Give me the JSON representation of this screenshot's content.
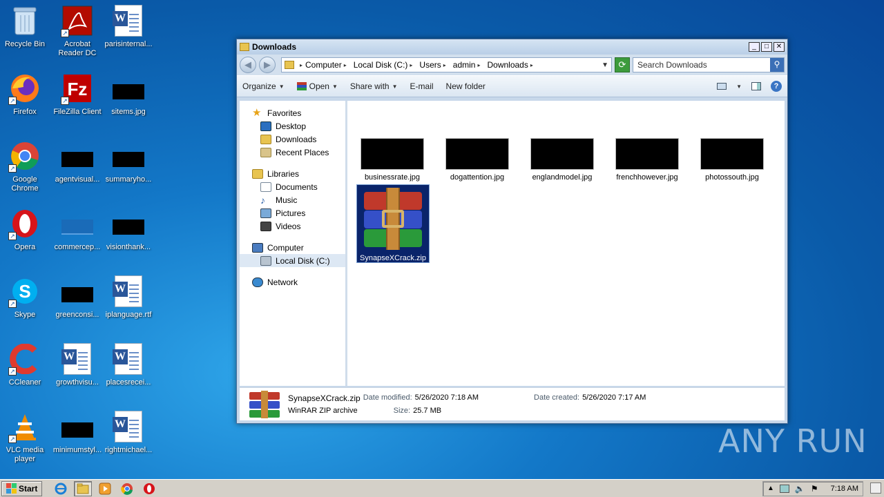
{
  "desktop": {
    "icons": [
      {
        "label": "Recycle Bin",
        "icon": "recycle-bin-icon"
      },
      {
        "label": "Acrobat Reader DC",
        "icon": "acrobat-icon"
      },
      {
        "label": "parisinternal...",
        "icon": "word-document-icon"
      },
      {
        "label": "Firefox",
        "icon": "firefox-icon"
      },
      {
        "label": "FileZilla Client",
        "icon": "filezilla-icon"
      },
      {
        "label": "sitems.jpg",
        "icon": "image-thumbnail-icon"
      },
      {
        "label": "Google Chrome",
        "icon": "chrome-icon"
      },
      {
        "label": "agentvisual...",
        "icon": "image-thumbnail-icon"
      },
      {
        "label": "summaryho...",
        "icon": "image-thumbnail-icon"
      },
      {
        "label": "Opera",
        "icon": "opera-icon"
      },
      {
        "label": "commercep...",
        "icon": "image-thumbnail-icon"
      },
      {
        "label": "visionthank...",
        "icon": "image-thumbnail-icon"
      },
      {
        "label": "Skype",
        "icon": "skype-icon"
      },
      {
        "label": "greenconsi...",
        "icon": "image-thumbnail-icon"
      },
      {
        "label": "iplanguage.rtf",
        "icon": "word-document-icon"
      },
      {
        "label": "CCleaner",
        "icon": "ccleaner-icon"
      },
      {
        "label": "growthvisu...",
        "icon": "word-document-icon"
      },
      {
        "label": "placesrecei...",
        "icon": "word-document-icon"
      },
      {
        "label": "VLC media player",
        "icon": "vlc-icon"
      },
      {
        "label": "minimumstyl...",
        "icon": "image-thumbnail-icon"
      },
      {
        "label": "rightmichael...",
        "icon": "word-document-icon"
      }
    ]
  },
  "watermark": "ANY RUN",
  "window": {
    "title": "Downloads",
    "controls": {
      "minimize": "_",
      "maximize": "□",
      "close": "✕"
    },
    "breadcrumbs": [
      "Computer",
      "Local Disk (C:)",
      "Users",
      "admin",
      "Downloads"
    ],
    "search_placeholder": "Search Downloads",
    "commands": {
      "organize": "Organize",
      "open": "Open",
      "share_with": "Share with",
      "email": "E-mail",
      "new_folder": "New folder"
    },
    "nav": {
      "favorites": "Favorites",
      "desktop": "Desktop",
      "downloads": "Downloads",
      "recent_places": "Recent Places",
      "libraries": "Libraries",
      "documents": "Documents",
      "music": "Music",
      "pictures": "Pictures",
      "videos": "Videos",
      "computer": "Computer",
      "local_disk": "Local Disk (C:)",
      "network": "Network"
    },
    "files": [
      {
        "name": "businessrate.jpg"
      },
      {
        "name": "dogattention.jpg"
      },
      {
        "name": "englandmodel.jpg"
      },
      {
        "name": "frenchhowever.jpg"
      },
      {
        "name": "photossouth.jpg"
      },
      {
        "name": "SynapseXCrack.zip"
      }
    ],
    "details": {
      "name": "SynapseXCrack.zip",
      "type": "WinRAR ZIP archive",
      "modified_label": "Date modified:",
      "modified_value": "5/26/2020 7:18 AM",
      "created_label": "Date created:",
      "created_value": "5/26/2020 7:17 AM",
      "size_label": "Size:",
      "size_value": "25.7 MB"
    }
  },
  "taskbar": {
    "start_label": "Start",
    "clock": "7:18 AM"
  }
}
